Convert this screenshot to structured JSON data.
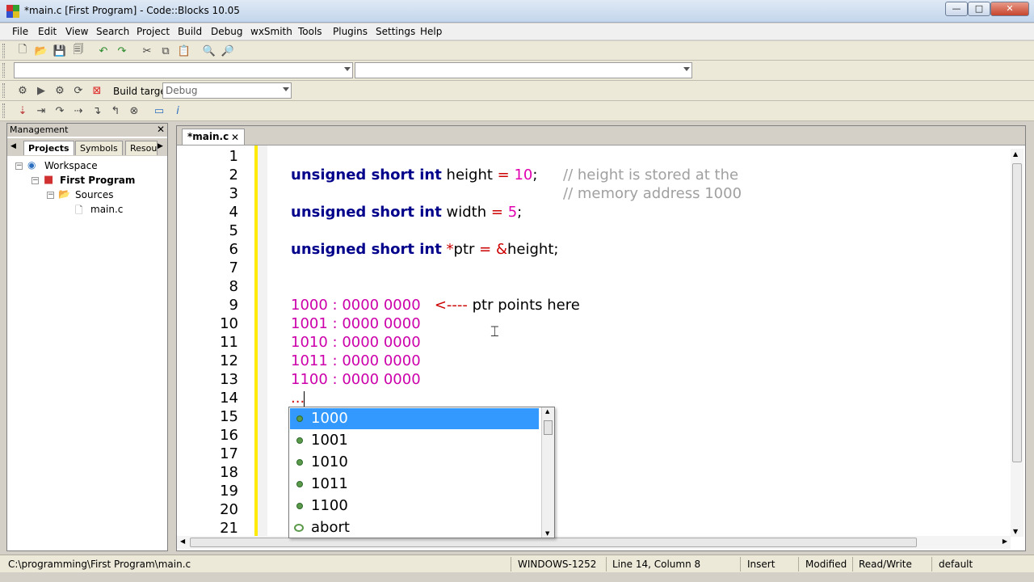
{
  "window": {
    "title": "*main.c [First Program] - Code::Blocks 10.05",
    "controls": {
      "minimize": "—",
      "maximize": "□",
      "close": "✕"
    }
  },
  "menu": [
    "File",
    "Edit",
    "View",
    "Search",
    "Project",
    "Build",
    "Debug",
    "wxSmith",
    "Tools",
    "Plugins",
    "Settings",
    "Help"
  ],
  "toolbar": {
    "build_target_label": "Build target:",
    "build_target_value": "Debug"
  },
  "management": {
    "title": "Management",
    "close": "✕",
    "tabs": [
      "Projects",
      "Symbols",
      "Resou"
    ],
    "tree": {
      "workspace": "Workspace",
      "project": "First Program",
      "folder": "Sources",
      "file": "main.c"
    }
  },
  "editor": {
    "tab_label": "*main.c",
    "tab_close": "✕",
    "line_numbers": [
      "1",
      "2",
      "3",
      "4",
      "5",
      "6",
      "7",
      "8",
      "9",
      "10",
      "11",
      "12",
      "13",
      "14",
      "15",
      "16",
      "17",
      "18",
      "19",
      "20",
      "21"
    ],
    "code": {
      "l2_kw": "unsigned short int",
      "l2_id": " height ",
      "l2_op": "=",
      "l2_num": " 10",
      "l2_semi": ";",
      "l2_comment": "// height is stored at the",
      "l3_comment": "// memory address 1000",
      "l4_kw": "unsigned short int",
      "l4_id": " width ",
      "l4_op": "=",
      "l4_num": " 5",
      "l4_semi": ";",
      "l6_kw": "unsigned short int",
      "l6_star": " *",
      "l6_id": "ptr ",
      "l6_op": "= &",
      "l6_id2": "height",
      "l6_semi": ";",
      "l9_addr": "1000 : 0000 0000",
      "l9_arrow": "<----",
      "l9_text": " ptr points here",
      "l10": "1001 : 0000 0000",
      "l11": "1010 : 0000 0000",
      "l12": "1011 : 0000 0000",
      "l13": "1100 : 0000 0000",
      "l14": "..."
    }
  },
  "autocomplete": {
    "items": [
      "1000",
      "1001",
      "1010",
      "1011",
      "1100",
      "abort"
    ],
    "selected": "1000"
  },
  "status": {
    "path": "C:\\programming\\First Program\\main.c",
    "encoding": "WINDOWS-1252",
    "position": "Line 14, Column 8",
    "mode": "Insert",
    "modified": "Modified",
    "access": "Read/Write",
    "lang": "default"
  },
  "colors": {
    "keyword": "#00008b",
    "number": "#e000b0",
    "operator": "#cc0000",
    "comment": "#a0a0a0",
    "selection": "#3399ff",
    "changebar": "#ffeb00"
  }
}
